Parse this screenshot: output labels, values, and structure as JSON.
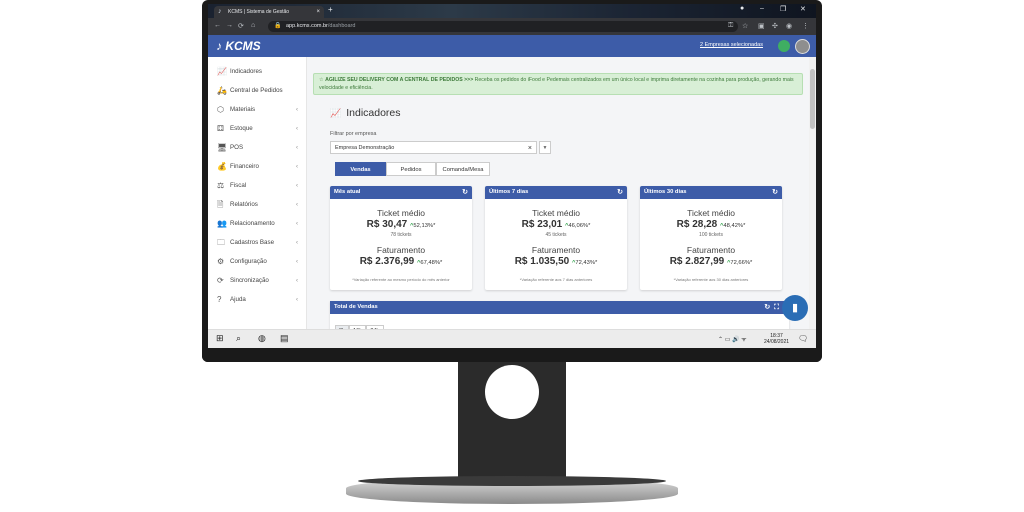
{
  "browser": {
    "tab_title": "KCMS | Sistema de Gestão",
    "tab_close": "×",
    "new_tab": "+",
    "url_host": "app.kcms.com.br",
    "url_path": "/dashboard",
    "win_minimize": "–",
    "win_restore": "❐",
    "win_close": "✕"
  },
  "header": {
    "logo": "KCMS",
    "company_link": "2 Empresas selecionadas"
  },
  "sidebar": {
    "items": [
      {
        "icon": "chart-line-icon",
        "glyph": "📈",
        "label": "Indicadores",
        "chevron": ""
      },
      {
        "icon": "scooter-icon",
        "glyph": "🛵",
        "label": "Central de Pedidos",
        "chevron": ""
      },
      {
        "icon": "cube-icon",
        "glyph": "⬡",
        "label": "Materiais",
        "chevron": "‹"
      },
      {
        "icon": "boxes-icon",
        "glyph": "⚃",
        "label": "Estoque",
        "chevron": "‹"
      },
      {
        "icon": "monitor-icon",
        "glyph": "🖥",
        "label": "POS",
        "chevron": "‹"
      },
      {
        "icon": "money-bag-icon",
        "glyph": "💰",
        "label": "Financeiro",
        "chevron": "‹"
      },
      {
        "icon": "balance-scale-icon",
        "glyph": "⚖",
        "label": "Fiscal",
        "chevron": "‹"
      },
      {
        "icon": "file-icon",
        "glyph": "🗎",
        "label": "Relatórios",
        "chevron": "‹"
      },
      {
        "icon": "people-icon",
        "glyph": "👥",
        "label": "Relacionamento",
        "chevron": "‹"
      },
      {
        "icon": "folder-icon",
        "glyph": "🗀",
        "label": "Cadastros Base",
        "chevron": "‹"
      },
      {
        "icon": "gears-icon",
        "glyph": "⚙",
        "label": "Configuração",
        "chevron": "‹"
      },
      {
        "icon": "sync-icon",
        "glyph": "⟳",
        "label": "Sincronização",
        "chevron": "‹"
      },
      {
        "icon": "question-icon",
        "glyph": "?",
        "label": "Ajuda",
        "chevron": "‹"
      }
    ]
  },
  "alert": {
    "title": "AGILIZE SEU DELIVERY COM A CENTRAL DE PEDIDOS >>>",
    "text": "Receba os pedidos do iFood e Pedemais centralizados em um único local e imprima diretamente na cozinha para produção, gerando mais velocidade e eficiência."
  },
  "page": {
    "title": "Indicadores",
    "filter_label": "Filtrar por empresa",
    "filter_value": "Empresa Demonstração",
    "tabs": [
      "Vendas",
      "Pedidos",
      "Comanda/Mesa"
    ]
  },
  "cards": [
    {
      "title": "Mês atual",
      "ticket_label": "Ticket médio",
      "ticket_value": "R$ 30,47",
      "ticket_pct": "52,13%*",
      "tickets": "78 tickets",
      "fat_label": "Faturamento",
      "fat_value": "R$ 2.376,99",
      "fat_pct": "67,48%*",
      "note": "*Variação referente ao mesmo período do mês anterior"
    },
    {
      "title": "Últimos 7 dias",
      "ticket_label": "Ticket médio",
      "ticket_value": "R$ 23,01",
      "ticket_pct": "46,06%*",
      "tickets": "45 tickets",
      "fat_label": "Faturamento",
      "fat_value": "R$ 1.035,50",
      "fat_pct": "72,43%*",
      "note": "*Variação referente aos 7 dias anteriores"
    },
    {
      "title": "Últimos 30 dias",
      "ticket_label": "Ticket médio",
      "ticket_value": "R$ 28,28",
      "ticket_pct": "48,42%*",
      "tickets": "100 tickets",
      "fat_label": "Faturamento",
      "fat_value": "R$ 2.827,99",
      "fat_pct": "72,66%*",
      "note": "*Variação referente aos 30 dias anteriores"
    }
  ],
  "total": {
    "title": "Total de Vendas",
    "ranges": [
      "8h",
      "16h",
      "24h"
    ]
  },
  "taskbar": {
    "time": "18:37",
    "date": "24/08/2021"
  },
  "colors": {
    "brand": "#3d5ca8",
    "positive": "#2fa24a",
    "alert_bg": "#d8efd6"
  }
}
